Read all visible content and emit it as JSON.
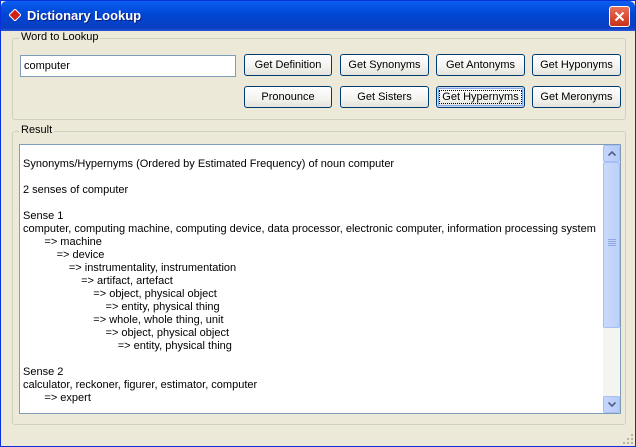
{
  "window": {
    "title": "Dictionary Lookup"
  },
  "lookup": {
    "group_label": "Word to Lookup",
    "word_value": "computer"
  },
  "buttons": {
    "get_definition": "Get Definition",
    "get_synonyms": "Get Synonyms",
    "get_antonyms": "Get  Antonyms",
    "get_hyponyms": "Get  Hyponyms",
    "pronounce": "Pronounce",
    "get_sisters": "Get Sisters",
    "get_hypernyms": "Get  Hypernyms",
    "get_meronyms": "Get Meronyms"
  },
  "result": {
    "group_label": "Result",
    "lines": [
      "Synonyms/Hypernyms (Ordered by Estimated Frequency) of noun computer",
      "",
      "2 senses of computer",
      "",
      "Sense 1",
      "computer, computing machine, computing device, data processor, electronic computer, information processing system",
      "       => machine",
      "           => device",
      "               => instrumentality, instrumentation",
      "                   => artifact, artefact",
      "                       => object, physical object",
      "                           => entity, physical thing",
      "                       => whole, whole thing, unit",
      "                           => object, physical object",
      "                               => entity, physical thing",
      "",
      "Sense 2",
      "calculator, reckoner, figurer, estimator, computer",
      "       => expert"
    ]
  },
  "icons": {
    "app": "diamond-icon",
    "close": "close-icon",
    "scroll_up": "arrow-up-icon",
    "scroll_down": "arrow-down-icon"
  }
}
